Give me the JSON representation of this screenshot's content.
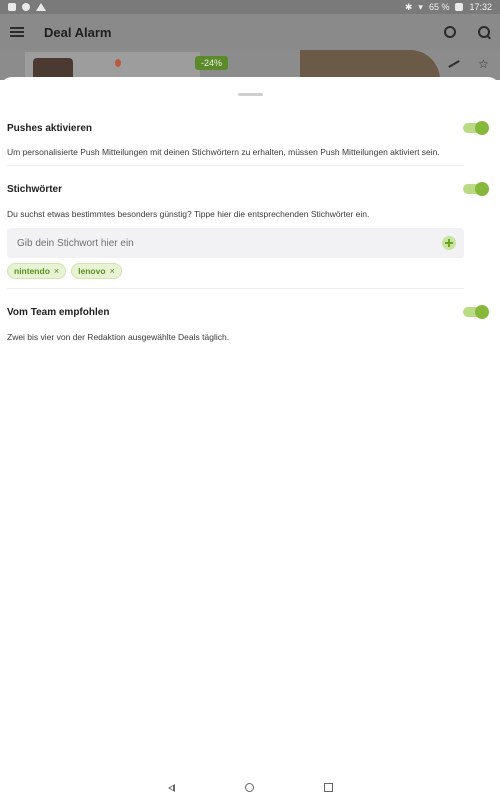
{
  "status_bar": {
    "battery": "65 %",
    "time": "17:32"
  },
  "app_bar": {
    "title": "Deal Alarm"
  },
  "background_deal": {
    "discount": "-24%",
    "temperature": "—"
  },
  "settings": [
    {
      "title": "Pushes aktivieren",
      "description": "Um personalisierte Push Mitteilungen mit deinen Stichwörtern zu erhalten, müssen Push Mitteilungen aktiviert sein.",
      "enabled": true
    },
    {
      "title": "Stichwörter",
      "description": "Du suchst etwas bestimmtes besonders günstig? Tippe hier die entsprechenden Stichwörter ein.",
      "enabled": true
    },
    {
      "title": "Vom Team empfohlen",
      "description": "Zwei bis vier von der Redaktion ausgewählte Deals täglich.",
      "enabled": true
    }
  ],
  "keyword_input": {
    "placeholder": "Gib dein Stichwort hier ein",
    "value": ""
  },
  "keywords": [
    "nintendo",
    "lenovo"
  ],
  "colors": {
    "accent": "#86b83b",
    "chip_bg": "#e8f3d6",
    "chip_text": "#5c8f1d"
  }
}
